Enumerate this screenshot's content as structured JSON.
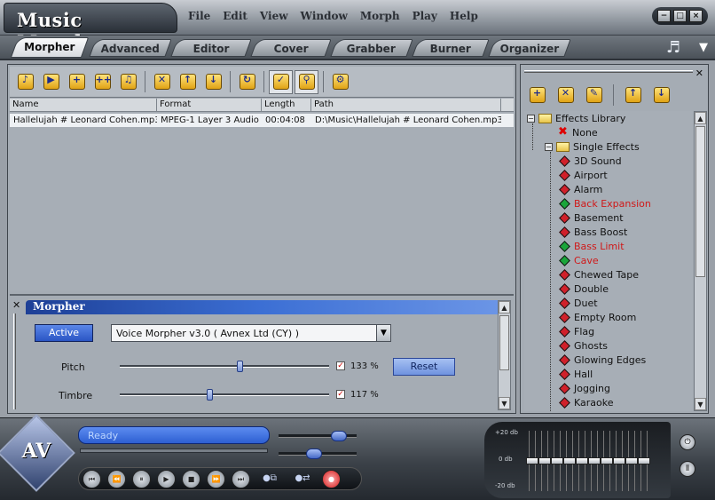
{
  "app": {
    "title": "Music Morpher",
    "menu": [
      "File",
      "Edit",
      "View",
      "Window",
      "Morph",
      "Play",
      "Help"
    ],
    "window_controls": [
      "−",
      "□",
      "×"
    ]
  },
  "tabs": [
    "Morpher",
    "Advanced",
    "Editor",
    "Cover",
    "Grabber",
    "Burner",
    "Organizer"
  ],
  "active_tab": "Morpher",
  "tabbar_icon": "music-note-icon",
  "toolbar": {
    "icons": [
      "open-file-icon",
      "open-folder-icon",
      "add-file-icon",
      "add-folder-icon",
      "save-icon",
      "remove-icon",
      "move-up-icon",
      "move-down-icon",
      "refresh-icon",
      "select-icon",
      "search-icon",
      "settings-icon"
    ]
  },
  "file_list": {
    "columns": [
      "Name",
      "Format",
      "Length",
      "Path"
    ],
    "rows": [
      {
        "name": "Hallelujah # Leonard Cohen.mp3",
        "format": "MPEG-1 Layer 3 Audio",
        "length": "00:04:08",
        "path": "D:\\Music\\Hallelujah # Leonard Cohen.mp3"
      }
    ]
  },
  "morpher": {
    "title": "Morpher",
    "active_label": "Active",
    "engine": "Voice Morpher v3.0 ( Avnex Ltd (CY) )",
    "pitch": {
      "label": "Pitch",
      "value": "133 %",
      "slider": 0.57,
      "checked": true
    },
    "timbre": {
      "label": "Timbre",
      "value": "117 %",
      "slider": 0.43,
      "checked": true
    },
    "reset_label": "Reset"
  },
  "effects": {
    "library_label": "Effects Library",
    "none_label": "None",
    "single_label": "Single Effects",
    "items": [
      {
        "label": "3D Sound",
        "color": "#111111",
        "icon_color": "#d0202a"
      },
      {
        "label": "Airport",
        "color": "#111111",
        "icon_color": "#d0202a"
      },
      {
        "label": "Alarm",
        "color": "#111111",
        "icon_color": "#d0202a"
      },
      {
        "label": "Back Expansion",
        "color": "#d01818",
        "icon_color": "#1aa53a"
      },
      {
        "label": "Basement",
        "color": "#111111",
        "icon_color": "#d0202a"
      },
      {
        "label": "Bass Boost",
        "color": "#111111",
        "icon_color": "#d0202a"
      },
      {
        "label": "Bass Limit",
        "color": "#d01818",
        "icon_color": "#1aa53a"
      },
      {
        "label": "Cave",
        "color": "#d01818",
        "icon_color": "#1aa53a"
      },
      {
        "label": "Chewed Tape",
        "color": "#111111",
        "icon_color": "#d0202a"
      },
      {
        "label": "Double",
        "color": "#111111",
        "icon_color": "#d0202a"
      },
      {
        "label": "Duet",
        "color": "#111111",
        "icon_color": "#d0202a"
      },
      {
        "label": "Empty Room",
        "color": "#111111",
        "icon_color": "#d0202a"
      },
      {
        "label": "Flag",
        "color": "#111111",
        "icon_color": "#d0202a"
      },
      {
        "label": "Ghosts",
        "color": "#111111",
        "icon_color": "#d0202a"
      },
      {
        "label": "Glowing Edges",
        "color": "#111111",
        "icon_color": "#d0202a"
      },
      {
        "label": "Hall",
        "color": "#111111",
        "icon_color": "#d0202a"
      },
      {
        "label": "Jogging",
        "color": "#111111",
        "icon_color": "#d0202a"
      },
      {
        "label": "Karaoke",
        "color": "#111111",
        "icon_color": "#d0202a"
      }
    ]
  },
  "player": {
    "status": "Ready",
    "eq_labels": [
      "+20 db",
      "0 db",
      "-20 db"
    ],
    "eq_bands": [
      0.5,
      0.5,
      0.5,
      0.5,
      0.5,
      0.5,
      0.5,
      0.5,
      0.5,
      0.5
    ],
    "volume": 0.77,
    "balance": 0.46,
    "transport": [
      "⏮",
      "⏪",
      "⏸",
      "▶",
      "■",
      "⏩",
      "⏭"
    ]
  }
}
